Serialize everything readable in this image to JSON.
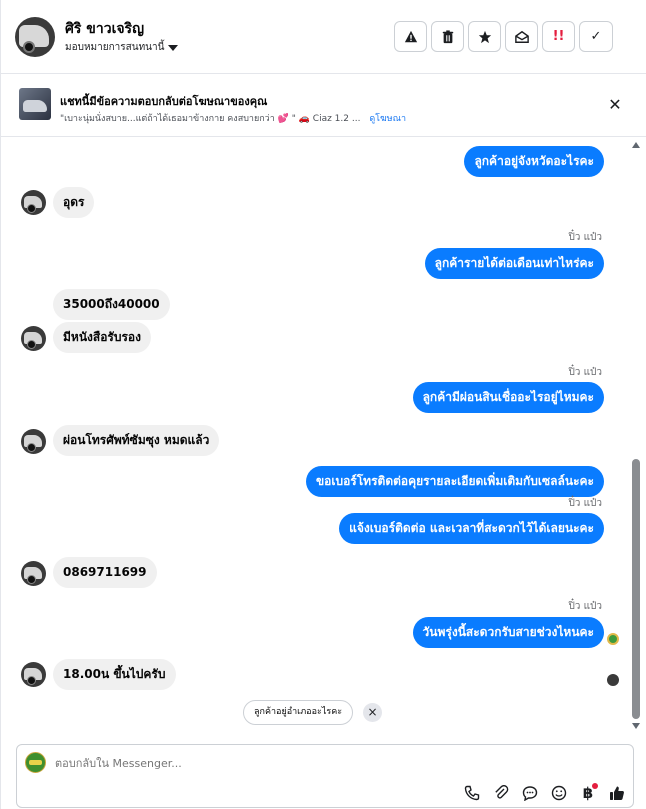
{
  "header": {
    "contact_name": "ศิริ ขาวเจริญ",
    "assign_label": "มอบหมายการสนทนานี้",
    "actions": {
      "spam": "warning-icon",
      "delete": "trash-icon",
      "star": "star-icon",
      "unread": "envelope-open-icon",
      "important": "!!",
      "done": "✓"
    }
  },
  "ad": {
    "title": "แชทนี้มีข้อความตอบกลับต่อโฆษณาของคุณ",
    "snippet": "\"เบาะนุ่มนั่งสบาย...แต่ถ้าได้เธอมาข้างกาย คงสบายกว่า 💕 \" 🚗 Ciaz 1.2 ...",
    "link": "ดูโฆษณา"
  },
  "messages": [
    {
      "dir": "out",
      "text": "ลูกค้าอยู่จังหวัดอะไรคะ",
      "sender": ""
    },
    {
      "dir": "in",
      "text": "อุดร"
    },
    {
      "dir": "out",
      "text": "ลูกค้ารายได้ต่อเดือนเท่าไหร่คะ",
      "sender": "ปิ๋ว แป๋ว"
    },
    {
      "dir": "in",
      "text": "35000ถึง40000"
    },
    {
      "dir": "in",
      "text": "มีหนังสือรับรอง"
    },
    {
      "dir": "out",
      "text": "ลูกค้ามีผ่อนสินเชื่ออะไรอยู่ไหมคะ",
      "sender": "ปิ๋ว แป๋ว"
    },
    {
      "dir": "in",
      "text": "ผ่อนโทรศัพท์ซัมซุง หมดแล้ว"
    },
    {
      "dir": "out",
      "text": "ขอเบอร์โทรติดต่อคุยรายละเอียดเพิ่มเติมกับเซลล์นะคะ",
      "sender": ""
    },
    {
      "dir": "out",
      "text": "แจ้งเบอร์ติดต่อ  และเวลาที่สะดวกไว้ได้เลยนะคะ",
      "sender": "ปิ๋ว แป๋ว"
    },
    {
      "dir": "in",
      "text": "0869711699"
    },
    {
      "dir": "out",
      "text": "วันพรุ่งนี้สะดวกรับสายช่วงไหนคะ",
      "sender": "ปิ๋ว แป๋ว"
    },
    {
      "dir": "in",
      "text": "18.00น ขึ้นไปครับ"
    }
  ],
  "suggestion": {
    "text": "ลูกค้าอยู่อำเภออะไรคะ",
    "dismiss": "×"
  },
  "composer": {
    "placeholder": "ตอบกลับใน Messenger...",
    "tools": [
      "call-icon",
      "attach-icon",
      "saved-reply-icon",
      "emoji-icon",
      "payment-icon",
      "like-icon"
    ]
  },
  "colors": {
    "outgoing_bubble": "#0a7cff",
    "incoming_bubble": "#f0f0f0",
    "link": "#1877f2"
  }
}
